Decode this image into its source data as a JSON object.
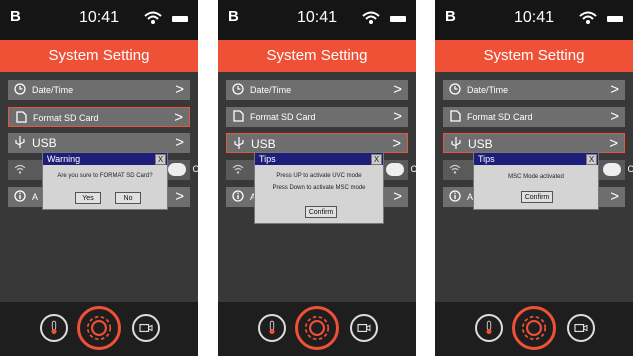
{
  "status": {
    "battery_glyph": "B",
    "time": "10:41"
  },
  "header": {
    "title": "System Setting"
  },
  "menu": {
    "datetime": "Date/Time",
    "format": "Format SD Card",
    "usb": "USB",
    "on": "ON",
    "about_initial": "A"
  },
  "dialogs": {
    "warning": {
      "title": "Warning",
      "message": "Are you sure to FORMAT SD Card?",
      "yes": "Yes",
      "no": "No"
    },
    "tips1": {
      "title": "Tips",
      "line1": "Press UP to activate UVC mode",
      "line2": "Press Down to activate MSC mode",
      "confirm": "Confirm"
    },
    "tips2": {
      "title": "Tips",
      "message": "MSC Mode activated",
      "confirm": "Confirm"
    }
  },
  "close_glyph": "X",
  "arrow": ">",
  "icons": [
    "battery-icon",
    "wifi-icon",
    "clock-icon",
    "sd-card-icon",
    "usb-icon",
    "info-icon",
    "thermometer-icon",
    "gear-icon",
    "camera-icon"
  ],
  "colors": {
    "header": "#ef5136",
    "selection": "#e8573b",
    "dialog_title": "#1e1e7a"
  }
}
